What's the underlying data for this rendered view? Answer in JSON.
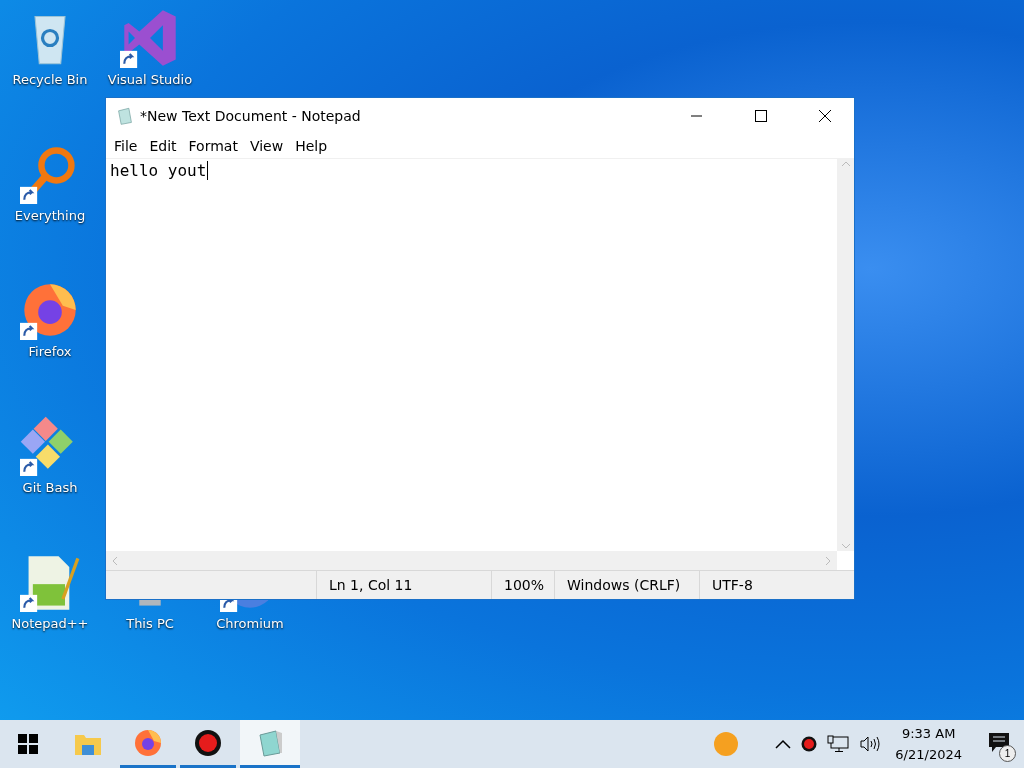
{
  "desktop_icons": [
    {
      "kind": "recycle-bin",
      "label": "Recycle Bin",
      "shortcut": false
    },
    {
      "kind": "visual-studio",
      "label": "Visual Studio",
      "shortcut": true
    },
    {
      "kind": "everything",
      "label": "Everything",
      "shortcut": true
    },
    {
      "kind": "firefox",
      "label": "Firefox",
      "shortcut": true
    },
    {
      "kind": "git",
      "label": "Git Bash",
      "shortcut": true
    },
    {
      "kind": "notepadpp",
      "label": "Notepad++",
      "shortcut": true
    },
    {
      "kind": "pc",
      "label": "This PC",
      "shortcut": false
    },
    {
      "kind": "chromium",
      "label": "Chromium",
      "shortcut": true
    }
  ],
  "window": {
    "title": "*New Text Document - Notepad",
    "menu": [
      "File",
      "Edit",
      "Format",
      "View",
      "Help"
    ],
    "content": "hello yout",
    "status_bar": [
      "Ln 1, Col 11",
      "100%",
      "Windows (CRLF)",
      "UTF-8"
    ]
  },
  "taskbar": {
    "items": [
      {
        "kind": "start",
        "running": false,
        "selected": false
      },
      {
        "kind": "explorer",
        "running": false,
        "selected": false
      },
      {
        "kind": "firefox",
        "running": true,
        "selected": false
      },
      {
        "kind": "recorder",
        "running": true,
        "selected": false
      },
      {
        "kind": "notepad",
        "running": true,
        "selected": true
      }
    ],
    "tray": {
      "time": "9:33 AM",
      "date": "6/21/2024",
      "notifications": "1"
    }
  }
}
